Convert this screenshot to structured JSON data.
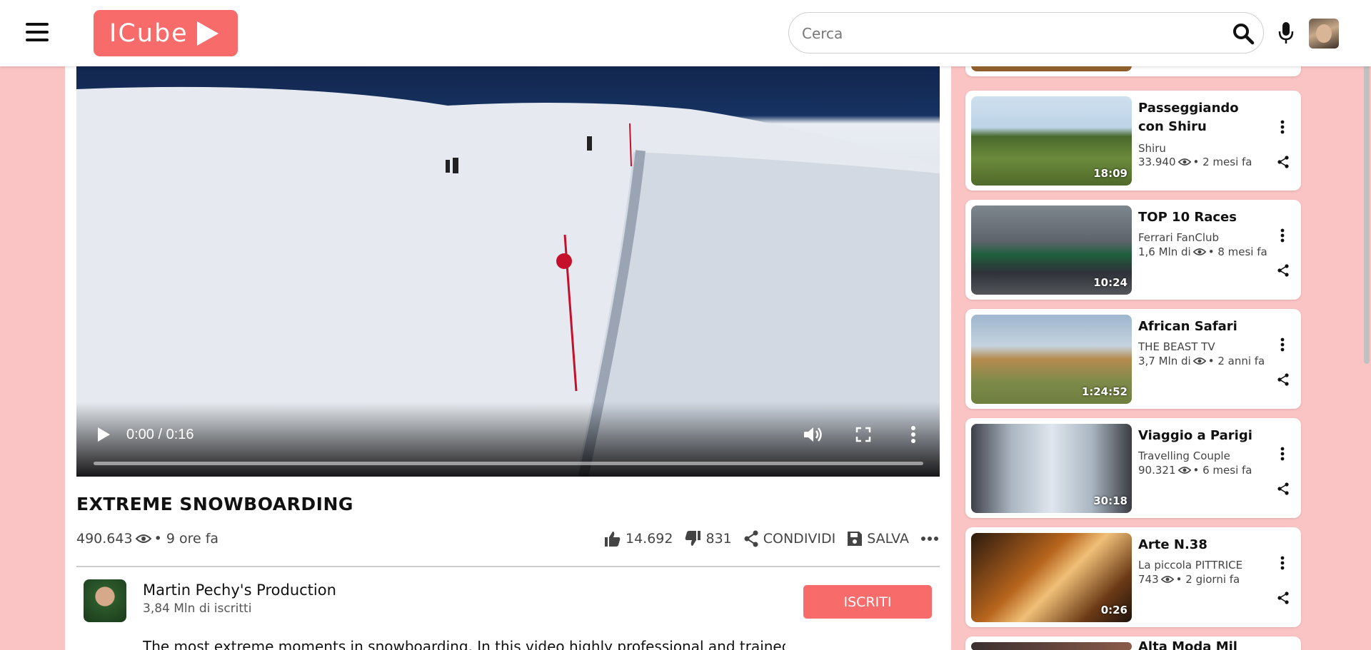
{
  "header": {
    "logo_text": "ICube",
    "search_placeholder": "Cerca"
  },
  "player": {
    "time": "0:00 / 0:16",
    "progress": 0
  },
  "video": {
    "title": "EXTREME SNOWBOARDING",
    "views": "490.643",
    "age": "• 9 ore fa",
    "likes": "14.692",
    "dislikes": "831",
    "share_label": "CONDIVIDI",
    "save_label": "SALVA"
  },
  "channel": {
    "name": "Martin Pechy's Production",
    "subscribers": "3,84 Mln di iscritti",
    "subscribe_label": "ISCRITI",
    "description": "The most extreme moments in snowboarding. In this video highly professional and trained"
  },
  "sidebar": [
    {
      "title": "Passeggiando con Shiru",
      "channel": "Shiru",
      "views": "33.940",
      "age": "• 2 mesi fa",
      "duration": "18:09",
      "thumb": "dog-walk"
    },
    {
      "title": "TOP 10 Races",
      "channel": "Ferrari FanClub",
      "views": "1,6 Mln di",
      "age": "• 8 mesi fa",
      "duration": "10:24",
      "thumb": "f1-cars"
    },
    {
      "title": "African Safari",
      "channel": "THE BEAST TV",
      "views": "3,7 Mln di",
      "age": "• 2 anni fa",
      "duration": "1:24:52",
      "thumb": "lions"
    },
    {
      "title": "Viaggio a Parigi",
      "channel": "Travelling Couple",
      "views": "90.321",
      "age": "• 6 mesi fa",
      "duration": "30:18",
      "thumb": "paris"
    },
    {
      "title": "Arte N.38",
      "channel": "La piccola PITTRICE",
      "views": "743",
      "age": "• 2 giorni fa",
      "duration": "0:26",
      "thumb": "painting"
    },
    {
      "title": "Alta Moda Mil",
      "thumb": "fashion"
    }
  ],
  "colors": {
    "accent": "#f76b6b",
    "background": "#fbc4c4"
  }
}
